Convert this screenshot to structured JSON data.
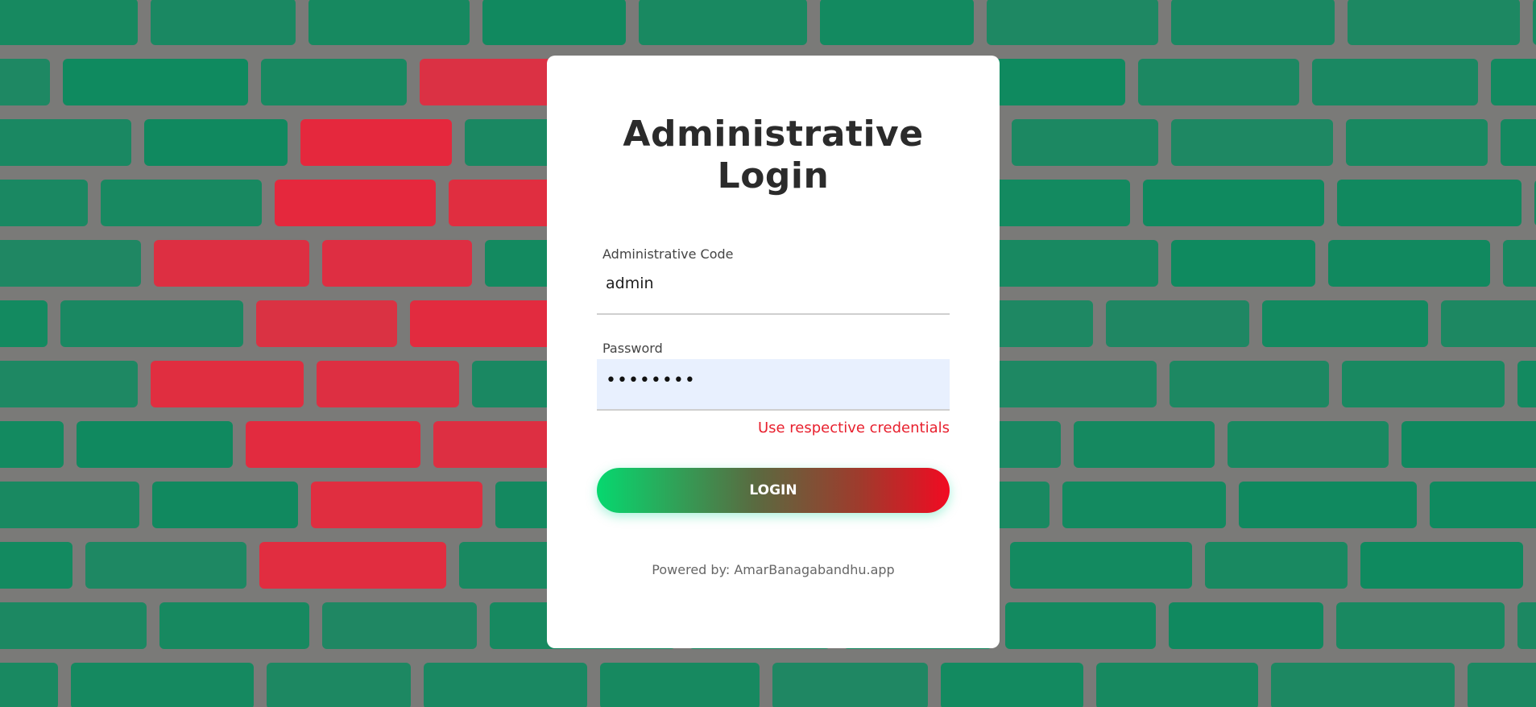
{
  "background": {
    "description_icon": "brick-wall-flag-background",
    "colors": {
      "mortar": "#7a7a78",
      "green": "#0f8a5f",
      "red": "#e8273c"
    }
  },
  "login": {
    "title_line1": "Administrative",
    "title_line2": "Login",
    "code_label": "Administrative Code",
    "code_value": "admin",
    "password_label": "Password",
    "password_value": "••••••••",
    "hint": "Use respective credentials",
    "button_label": "LOGIN",
    "footer": "Powered by: AmarBanagabandhu.app"
  },
  "colors": {
    "hint": "#e8202e",
    "button_start": "#06d86f",
    "button_end": "#f20a22",
    "autofill_bg": "#e8f0fe"
  }
}
